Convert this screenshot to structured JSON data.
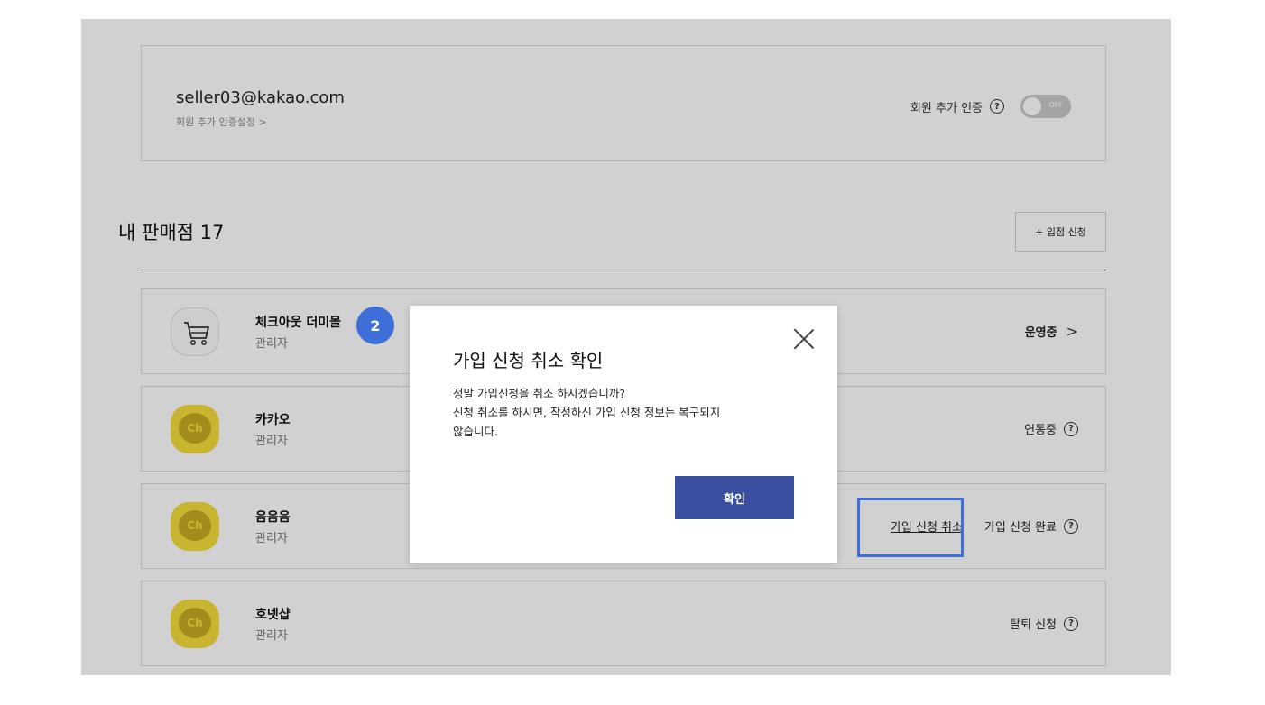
{
  "account": {
    "email": "seller03@kakao.com",
    "auth_settings_link": "회원 추가 인증설정 >",
    "auth_label": "회원 추가 인증",
    "help_glyph": "?",
    "toggle_state": "OFF"
  },
  "section": {
    "title": "내 판매점 17",
    "apply_button": "+ 입점 신청"
  },
  "stores": [
    {
      "name": "체크아웃 더미몰",
      "role": "관리자",
      "icon": "cart-icon",
      "status": "운영중",
      "chevron": ">"
    },
    {
      "name": "카카오",
      "role": "관리자",
      "icon": "kakao-channel-icon",
      "icon_text": "Ch",
      "status": "연동중",
      "help": "?"
    },
    {
      "name": "음음음",
      "role": "관리자",
      "icon": "kakao-channel-icon",
      "icon_text": "Ch",
      "cancel_link": "가입 신청 취소",
      "status": "가입 신청 완료",
      "help": "?"
    },
    {
      "name": "호넷샵",
      "role": "관리자",
      "icon": "kakao-channel-icon",
      "icon_text": "Ch",
      "status": "탈퇴 신청",
      "help": "?"
    }
  ],
  "step_badge": "2",
  "modal": {
    "title": "가입 신청 취소 확인",
    "body_line1": "정말 가입신청을 취소 하시겠습니까?",
    "body_line2": "신청 취소를 하시면, 작성하신 가입 신청 정보는 복구되지",
    "body_line3": "않습니다.",
    "confirm_button": "확인"
  },
  "colors": {
    "accent_blue": "#3e6fd8",
    "confirm_navy": "#3a4fa0",
    "kakao_yellow": "#f5dc3a"
  }
}
